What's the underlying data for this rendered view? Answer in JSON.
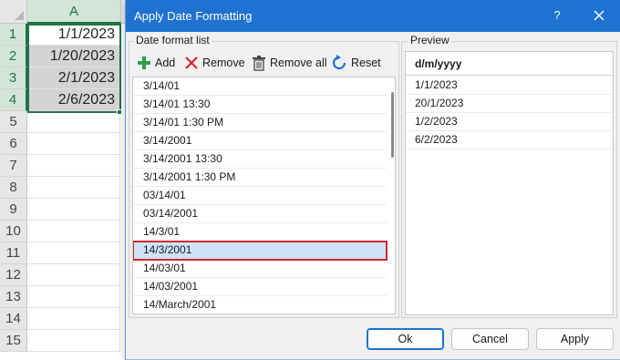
{
  "sheet": {
    "column_header": "A",
    "row_numbers": [
      "1",
      "2",
      "3",
      "4",
      "5",
      "6",
      "7",
      "8",
      "9",
      "10",
      "11",
      "12",
      "13",
      "14",
      "15"
    ],
    "cells": [
      "1/1/2023",
      "1/20/2023",
      "2/1/2023",
      "2/6/2023"
    ]
  },
  "dialog": {
    "title": "Apply Date Formatting",
    "help_label": "?",
    "format_group_label": "Date format list",
    "preview_group_label": "Preview",
    "toolbar": {
      "add_label": "Add",
      "remove_label": "Remove",
      "remove_all_label": "Remove all",
      "reset_label": "Reset"
    },
    "formats": [
      "3/14/01",
      "3/14/01 13:30",
      "3/14/01 1:30 PM",
      "3/14/2001",
      "3/14/2001 13:30",
      "3/14/2001 1:30 PM",
      "03/14/01",
      "03/14/2001",
      "14/3/01",
      "14/3/2001",
      "14/03/01",
      "14/03/2001",
      "14/March/2001"
    ],
    "selected_format": "14/3/2001",
    "preview": {
      "header": "d/m/yyyy",
      "items": [
        "1/1/2023",
        "20/1/2023",
        "1/2/2023",
        "6/2/2023"
      ]
    },
    "buttons": {
      "ok_label": "Ok",
      "cancel_label": "Cancel",
      "apply_label": "Apply"
    }
  },
  "colors": {
    "title_bar": "#1f72d1",
    "selection_highlight": "#cfe3f7",
    "selection_outline": "#d7262d",
    "sheet_selection": "#217346",
    "add_icon": "#2e9e4f",
    "remove_icon": "#d7262d",
    "reset_icon": "#1f72d1"
  },
  "icons": {
    "add": "plus-icon",
    "remove": "x-icon",
    "remove_all": "trash-icon",
    "reset": "reset-icon",
    "close": "close-icon"
  }
}
